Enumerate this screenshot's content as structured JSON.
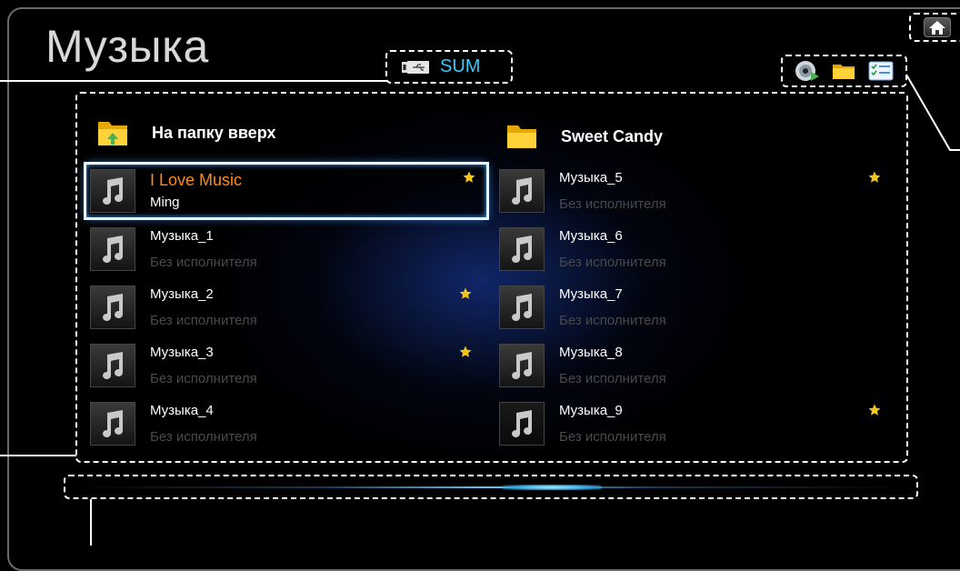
{
  "header": {
    "title": "Музыка"
  },
  "device": {
    "label": "SUM",
    "icon": "usb-device-icon"
  },
  "toolbar": {
    "icons": [
      "disc-play-icon",
      "folder-icon",
      "checklist-icon"
    ]
  },
  "home": {
    "icon": "home-icon"
  },
  "folders": {
    "up": {
      "label": "На папку вверх",
      "icon": "folder-up-icon"
    },
    "folder": {
      "label": "Sweet Candy",
      "icon": "folder-icon"
    }
  },
  "tracks": [
    {
      "title": "I Love Music",
      "artist": "Ming",
      "starred": true,
      "selected": true
    },
    {
      "title": "Музыка_1",
      "artist": "Без исполнителя",
      "starred": false
    },
    {
      "title": "Музыка_2",
      "artist": "Без исполнителя",
      "starred": true
    },
    {
      "title": "Музыка_3",
      "artist": "Без исполнителя",
      "starred": true
    },
    {
      "title": "Музыка_4",
      "artist": "Без исполнителя",
      "starred": false
    },
    {
      "title": "Музыка_5",
      "artist": "Без исполнителя",
      "starred": true
    },
    {
      "title": "Музыка_6",
      "artist": "Без исполнителя",
      "starred": false
    },
    {
      "title": "Музыка_7",
      "artist": "Без исполнителя",
      "starred": false
    },
    {
      "title": "Музыка_8",
      "artist": "Без исполнителя",
      "starred": false
    },
    {
      "title": "Музыка_9",
      "artist": "Без исполнителя",
      "starred": true
    }
  ],
  "colors": {
    "accent": "#33ccff",
    "selected_title": "#ff8a1a",
    "star": "#f5c518"
  }
}
